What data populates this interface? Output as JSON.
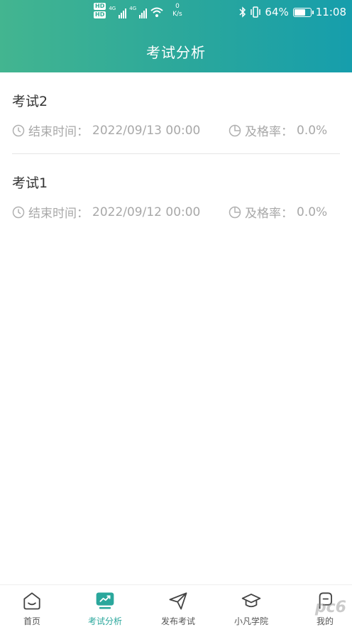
{
  "status_bar": {
    "hd1": "HD",
    "hd2": "HD",
    "signal1_tag": "4G",
    "signal2_tag": "4G",
    "net_speed_value": "0",
    "net_speed_unit": "K/s",
    "battery_percent": "64%",
    "battery_level": 0.64,
    "time": "11:08"
  },
  "header": {
    "title": "考试分析"
  },
  "exams": [
    {
      "name": "考试2",
      "end_time_label": "结束时间：",
      "end_time": "2022/09/13 00:00",
      "pass_rate_label": "及格率：",
      "pass_rate": "0.0%"
    },
    {
      "name": "考试1",
      "end_time_label": "结束时间：",
      "end_time": "2022/09/12 00:00",
      "pass_rate_label": "及格率：",
      "pass_rate": "0.0%"
    }
  ],
  "tabbar": {
    "items": [
      {
        "label": "首页",
        "icon": "home-icon"
      },
      {
        "label": "考试分析",
        "icon": "chart-icon"
      },
      {
        "label": "发布考试",
        "icon": "send-icon"
      },
      {
        "label": "小凡学院",
        "icon": "graduation-cap-icon"
      },
      {
        "label": "我的",
        "icon": "profile-icon"
      }
    ],
    "active_index": 1
  },
  "colors": {
    "accent": "#2aa79c",
    "header_start": "#43b590",
    "header_end": "#169eac",
    "meta_text": "#a8a8a8"
  },
  "watermark": "pc6"
}
